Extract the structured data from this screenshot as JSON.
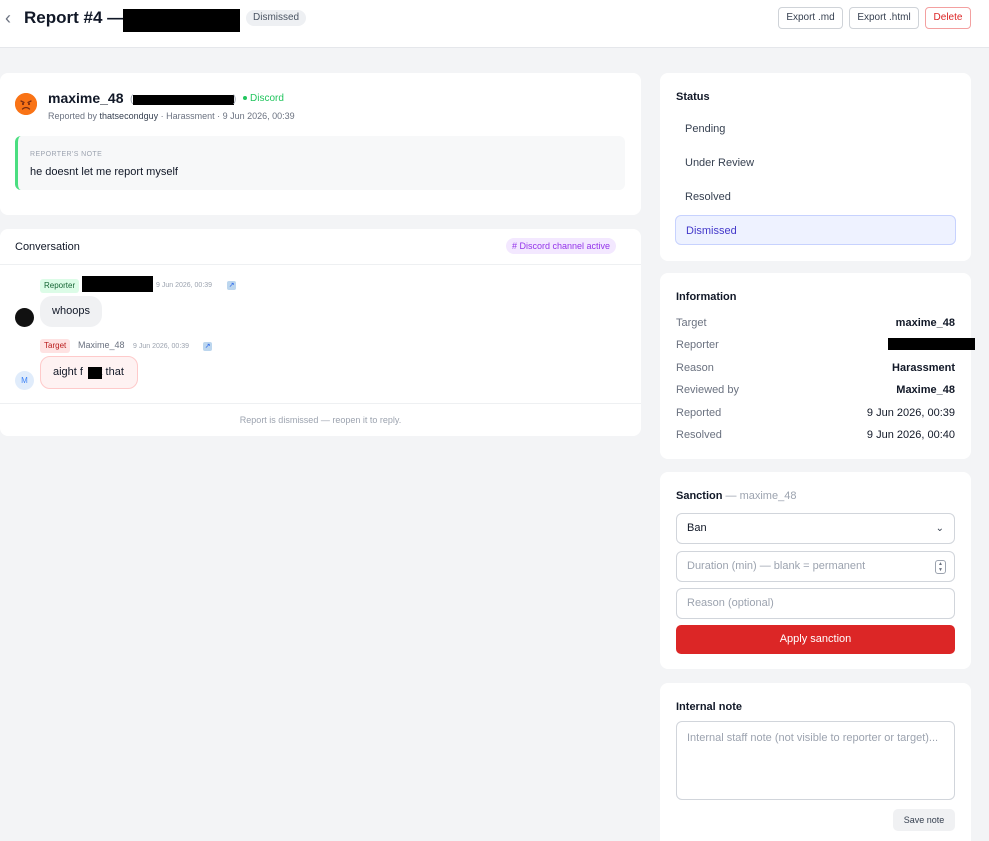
{
  "header": {
    "title": "Report #4 —",
    "status_badge": "Dismissed",
    "export_md": "Export .md",
    "export_html": "Export .html",
    "delete": "Delete"
  },
  "report": {
    "username": "maxime_48",
    "platform": "Discord",
    "reported_by_prefix": "Reported by",
    "reporter": "thatsecondguy",
    "reported_suffix": "· Harassment · 9 Jun 2026, 00:39",
    "note_title": "REPORTER'S NOTE",
    "note_text": "he doesnt let me report myself"
  },
  "conversation": {
    "title": "Conversation",
    "channel_chip": "# Discord channel active",
    "messages": [
      {
        "tag": "Reporter",
        "name": "",
        "time": "9 Jun 2026, 00:39",
        "text": "whoops"
      },
      {
        "tag": "Target",
        "name": "Maxime_48",
        "time": "9 Jun 2026, 00:39",
        "text_before": "aight f",
        "text_after": "k that",
        "avatar_letter": "M"
      }
    ],
    "footer": "Report is dismissed — reopen it to reply."
  },
  "status": {
    "title": "Status",
    "options": [
      "Pending",
      "Under Review",
      "Resolved",
      "Dismissed"
    ],
    "active": "Dismissed"
  },
  "information": {
    "title": "Information",
    "rows": [
      {
        "label": "Target",
        "value": "maxime_48"
      },
      {
        "label": "Reporter",
        "value": ""
      },
      {
        "label": "Reason",
        "value": "Harassment"
      },
      {
        "label": "Reviewed by",
        "value": "Maxime_48"
      },
      {
        "label": "Reported",
        "value": "9 Jun 2026, 00:39"
      },
      {
        "label": "Resolved",
        "value": "9 Jun 2026, 00:40"
      }
    ]
  },
  "sanction": {
    "title": "Sanction",
    "subject": "— maxime_48",
    "type_value": "Ban",
    "duration_placeholder": "Duration (min) — blank = permanent",
    "reason_placeholder": "Reason (optional)",
    "apply_label": "Apply sanction"
  },
  "internal_note": {
    "title": "Internal note",
    "placeholder": "Internal staff note (not visible to reporter or target)...",
    "save_label": "Save note"
  },
  "icons": {
    "back": "chevron-left-icon",
    "angry": "angry-face-icon",
    "link": "external-link-icon",
    "chevron": "chevron-down-icon",
    "stepper": "stepper-icon"
  },
  "colors": {
    "accent_red": "#dc2626",
    "discord_green": "#22c55e",
    "active_status": "#eef2ff"
  }
}
